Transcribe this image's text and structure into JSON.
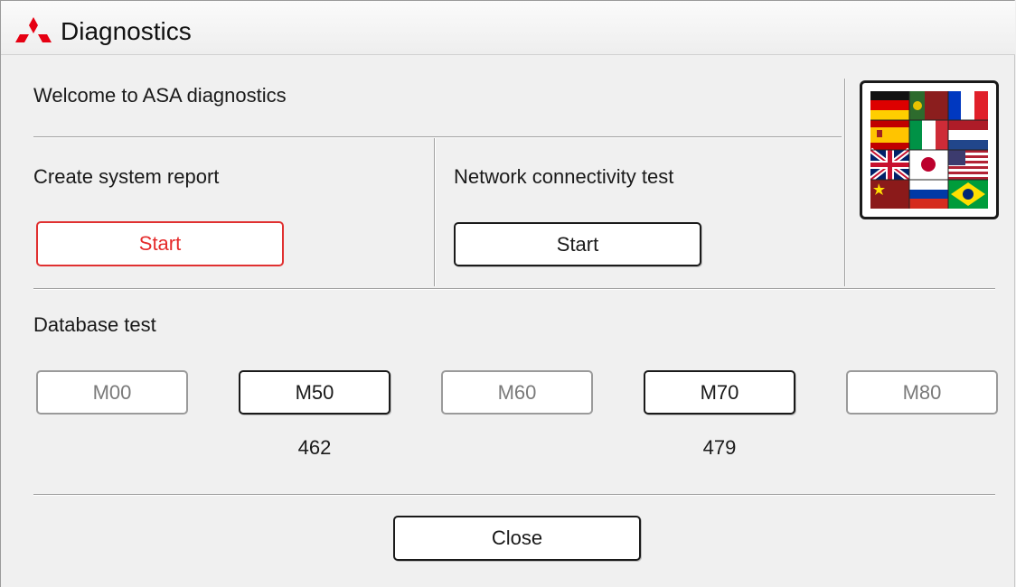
{
  "window": {
    "title": "Diagnostics",
    "logo_icon": "mitsubishi-logo-icon",
    "logo_color": "#e60012"
  },
  "welcome_text": "Welcome to ASA diagnostics",
  "system_report": {
    "label": "Create system report",
    "button_label": "Start"
  },
  "network_test": {
    "label": "Network connectivity test",
    "button_label": "Start"
  },
  "language_button": {
    "icon": "language-flags-icon"
  },
  "database_test": {
    "label": "Database test",
    "buttons": [
      {
        "label": "M00",
        "enabled": false,
        "count": ""
      },
      {
        "label": "M50",
        "enabled": true,
        "count": "462"
      },
      {
        "label": "M60",
        "enabled": false,
        "count": ""
      },
      {
        "label": "M70",
        "enabled": true,
        "count": "479"
      },
      {
        "label": "M80",
        "enabled": false,
        "count": ""
      }
    ]
  },
  "close_button": {
    "label": "Close"
  },
  "colors": {
    "accent_red": "#e03030",
    "background": "#f0f0f0"
  }
}
